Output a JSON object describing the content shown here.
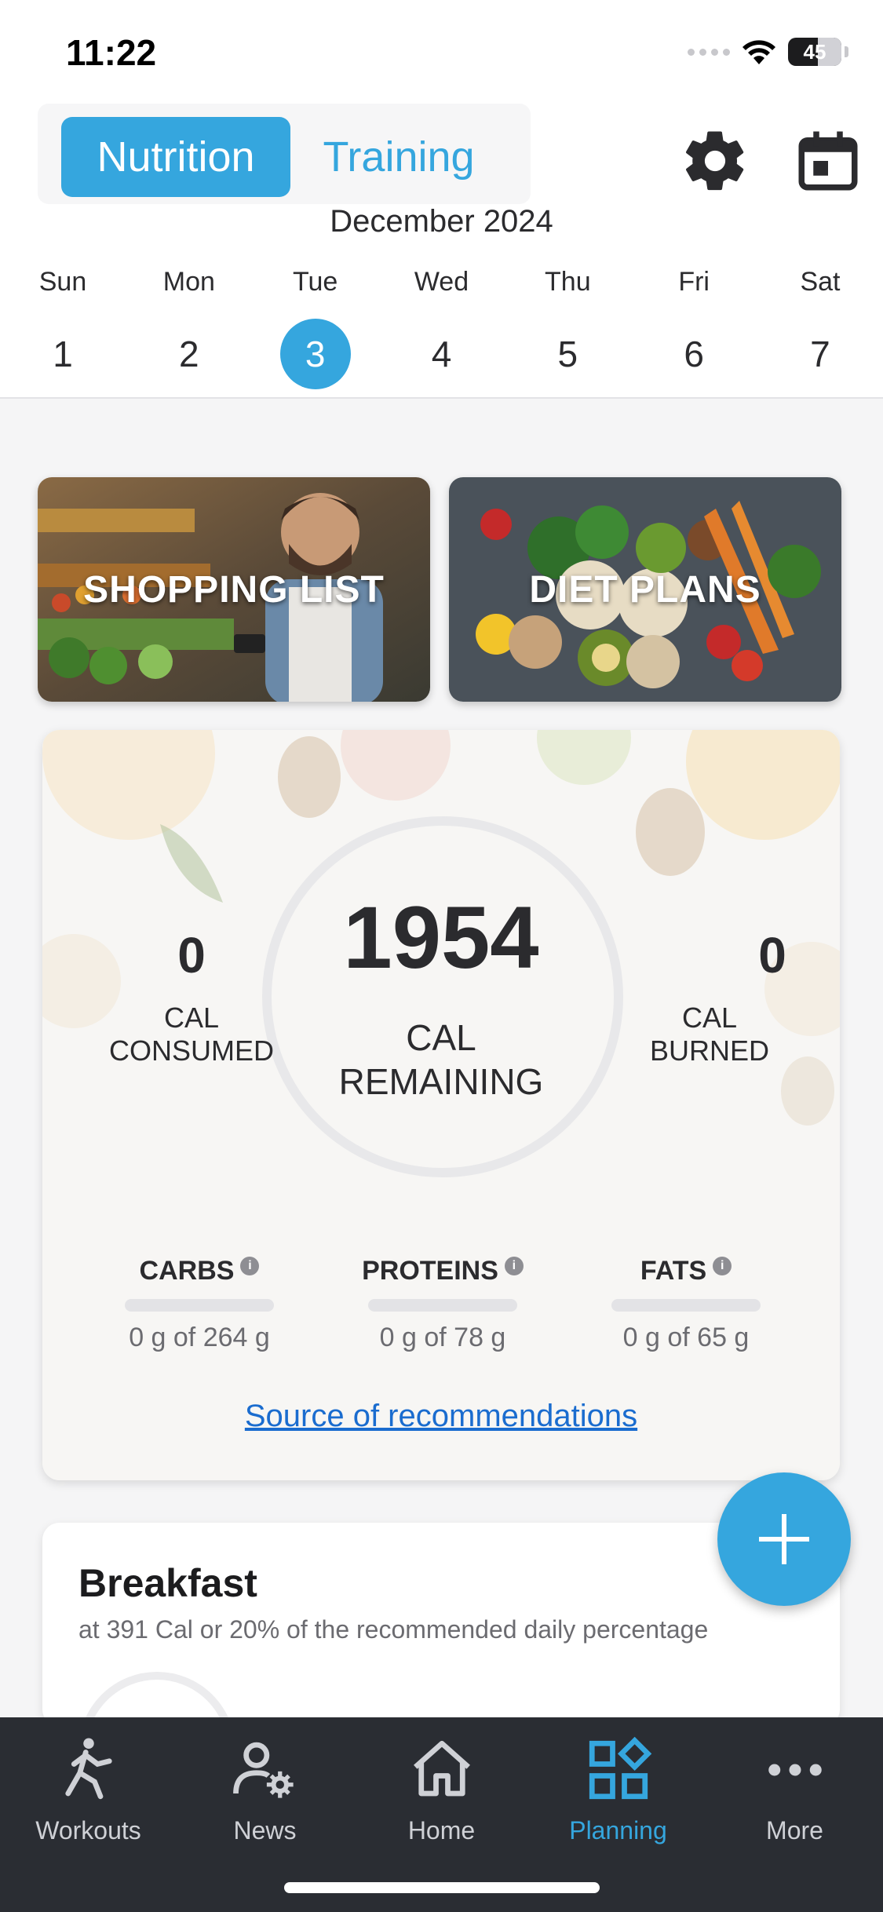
{
  "status_bar": {
    "time": "11:22",
    "battery": "45"
  },
  "header": {
    "toggle": {
      "active": "Nutrition",
      "inactive": "Training"
    },
    "icons": {
      "settings": "gear-icon",
      "calendar": "calendar-icon"
    },
    "month": "December 2024",
    "days": [
      {
        "name": "Sun",
        "num": "1"
      },
      {
        "name": "Mon",
        "num": "2"
      },
      {
        "name": "Tue",
        "num": "3",
        "selected": true
      },
      {
        "name": "Wed",
        "num": "4"
      },
      {
        "name": "Thu",
        "num": "5"
      },
      {
        "name": "Fri",
        "num": "6"
      },
      {
        "name": "Sat",
        "num": "7"
      }
    ]
  },
  "tiles": {
    "shopping": "SHOPPING LIST",
    "diet": "DIET PLANS"
  },
  "calories": {
    "remaining": "1954",
    "remaining_label": "CAL REMAINING",
    "consumed": "0",
    "consumed_label": "CAL CONSUMED",
    "burned": "0",
    "burned_label": "CAL BURNED"
  },
  "macros": [
    {
      "title": "CARBS",
      "value": "0 g of 264 g",
      "progress": 0
    },
    {
      "title": "PROTEINS",
      "value": "0 g of 78 g",
      "progress": 0
    },
    {
      "title": "FATS",
      "value": "0 g of 65 g",
      "progress": 0
    }
  ],
  "source_link": "Source of recommendations",
  "breakfast": {
    "title": "Breakfast",
    "subtitle": "at 391 Cal or 20% of the recommended daily percentage"
  },
  "tabbar": [
    {
      "label": "Workouts",
      "icon": "workout-icon"
    },
    {
      "label": "News",
      "icon": "news-icon"
    },
    {
      "label": "Home",
      "icon": "home-icon"
    },
    {
      "label": "Planning",
      "icon": "planning-icon",
      "active": true
    },
    {
      "label": "More",
      "icon": "more-icon"
    }
  ],
  "colors": {
    "accent": "#35a6de",
    "tabbar_bg": "#2a2d33",
    "link": "#1a6ccf"
  }
}
